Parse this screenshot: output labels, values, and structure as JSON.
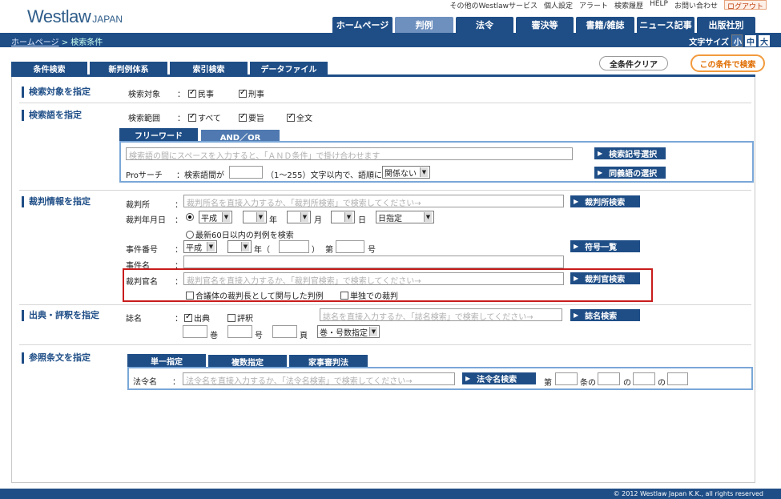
{
  "brand": {
    "name": "Westlaw",
    "suffix": "JAPAN"
  },
  "utility": [
    "その他のWestlawサービス",
    "個人設定",
    "アラート",
    "検索履歴",
    "HELP",
    "お問い合わせ",
    "ログアウト"
  ],
  "nav": {
    "tabs": [
      "ホームページ",
      "判例",
      "法令",
      "審決等",
      "書籍/雑誌",
      "ニュース記事",
      "出版社別"
    ],
    "active": "判例"
  },
  "breadcrumb": {
    "home": "ホームページ",
    "current": "> 検索条件"
  },
  "fontsize": {
    "label": "文字サイズ",
    "small": "小",
    "medium": "中",
    "large": "大"
  },
  "subtabs": [
    "条件検索",
    "新判例体系",
    "索引検索",
    "データファイル"
  ],
  "actions": {
    "clear": "全条件クリア",
    "search": "この条件で検索"
  },
  "target": {
    "title": "検索対象を指定",
    "label": "検索対象",
    "civil": "民事",
    "criminal": "刑事"
  },
  "terms": {
    "title": "検索語を指定",
    "range_label": "検索範囲",
    "all": "すべて",
    "summary": "要旨",
    "fulltext": "全文",
    "tab_free": "フリーワード",
    "tab_andor": "AND／OR",
    "placeholder": "検索語の間にスペースを入力すると、「ＡＮＤ条件」で掛け合わせます",
    "symbol_btn": "検索記号選択",
    "pro_label": "Proサーチ",
    "pro_between": "：検索語間が",
    "pro_hint": "（1～255）文字以内で、語順に",
    "order_select": "関係ない",
    "synonym_btn": "同義語の選択"
  },
  "judgment": {
    "title": "裁判情報を指定",
    "court_label": "裁判所",
    "court_placeholder": "裁判所名を直接入力するか、「裁判所検索」で検索してください→",
    "court_btn": "裁判所検索",
    "date_label": "裁判年月日",
    "era": "平成",
    "year_unit": "年",
    "month_unit": "月",
    "day_unit": "日",
    "date_mode": "日指定",
    "recent": "最新60日以内の判例を検索",
    "case_no_label": "事件番号",
    "case_era": "平成",
    "paren_open": "年（",
    "paren_close": "）",
    "dai": "第",
    "go": "号",
    "case_no_btn": "符号一覧",
    "case_name_label": "事件名",
    "judge_label": "裁判官名",
    "judge_placeholder": "裁判官名を直接入力するか、「裁判官検索」で検索してください→",
    "judge_btn": "裁判官検索",
    "panel_chief": "合議体の裁判長として関与した判例",
    "single": "単独での裁判"
  },
  "source": {
    "title": "出典・評釈を指定",
    "label": "誌名",
    "source": "出典",
    "comment": "評釈",
    "placeholder": "誌名を直接入力するか、「誌名検索」で検索してください→",
    "btn": "誌名検索",
    "vol": "巻",
    "no": "号",
    "page": "頁",
    "mode": "巻・号数指定"
  },
  "article": {
    "title": "参照条文を指定",
    "tabs": [
      "単一指定",
      "複数指定",
      "家事審判法"
    ],
    "law_label": "法令名",
    "placeholder": "法令名を直接入力するか、「法令名検索」で検索してください→",
    "btn": "法令名検索",
    "dai": "第",
    "jo_no": "条の",
    "no1": "の",
    "no2": "の"
  },
  "footer": "© 2012 Westlaw Japan K.K., all rights reserved"
}
